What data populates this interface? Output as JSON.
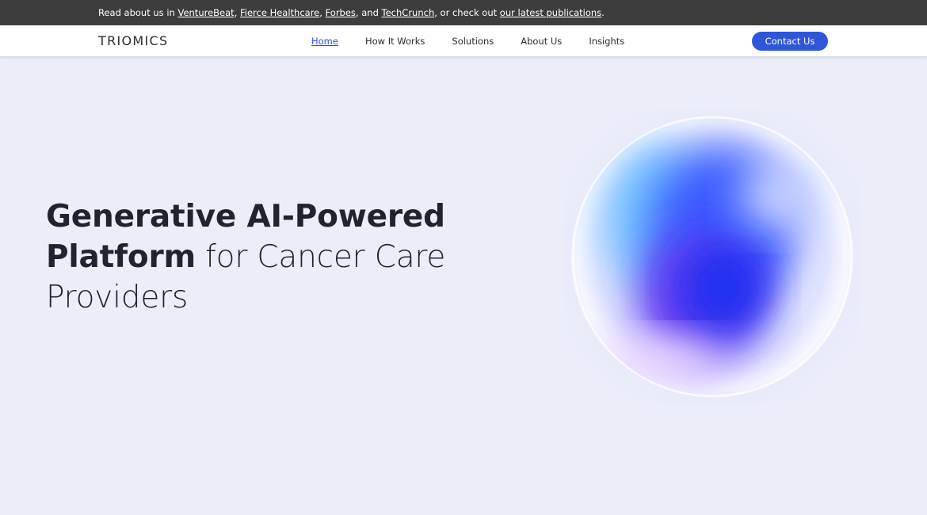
{
  "announcement": {
    "prefix": "Read about us in ",
    "links": [
      "VentureBeat",
      "Fierce Healthcare",
      "Forbes",
      "TechCrunch"
    ],
    "sep1": ", ",
    "sep2": ", ",
    "sep3": ", and ",
    "middle": ", or check out ",
    "publications_link": "our latest publications",
    "suffix": "."
  },
  "nav": {
    "logo": "TRIOMICS",
    "items": [
      {
        "label": "Home",
        "active": true
      },
      {
        "label": "How It Works"
      },
      {
        "label": "Solutions"
      },
      {
        "label": "About Us"
      },
      {
        "label": "Insights"
      }
    ],
    "cta": "Contact Us"
  },
  "hero": {
    "line1": "Generative AI-Powered",
    "line2_bold": "Platform",
    "line2_rest": " for Cancer Care",
    "line3": "Providers"
  },
  "colors": {
    "topbar_bg": "#3d3d3d",
    "page_bg": "#ebedf9",
    "accent": "#2f55d9",
    "text": "#23232c"
  },
  "icons": {
    "hero_graphic": "gradient-orb"
  }
}
